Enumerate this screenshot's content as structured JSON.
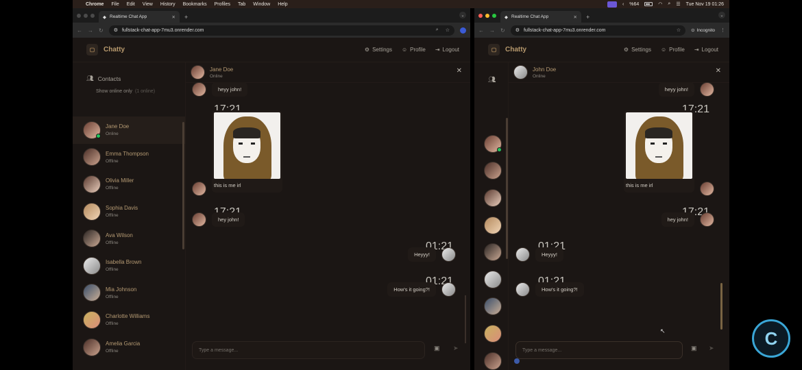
{
  "menubar": {
    "app": "Chrome",
    "items": [
      "File",
      "Edit",
      "View",
      "History",
      "Bookmarks",
      "Profiles",
      "Tab",
      "Window",
      "Help"
    ],
    "battery": "%64",
    "datetime": "Tue Nov 19  01:26"
  },
  "browser": {
    "tab_title": "Realtime Chat App",
    "url": "fullstack-chat-app-7mu3.onrender.com",
    "incognito_label": "Incognito"
  },
  "app": {
    "name": "Chatty",
    "nav": {
      "settings": "Settings",
      "profile": "Profile",
      "logout": "Logout"
    }
  },
  "left": {
    "sidebar": {
      "title": "Contacts",
      "online_filter": "Show online only",
      "online_count": "(1 online)",
      "contacts": [
        {
          "name": "Jane Doe",
          "status": "Online"
        },
        {
          "name": "Emma Thompson",
          "status": "Offline"
        },
        {
          "name": "Olivia Miller",
          "status": "Offline"
        },
        {
          "name": "Sophia Davis",
          "status": "Offline"
        },
        {
          "name": "Ava Wilson",
          "status": "Offline"
        },
        {
          "name": "Isabella Brown",
          "status": "Offline"
        },
        {
          "name": "Mia Johnson",
          "status": "Offline"
        },
        {
          "name": "Charlotte Williams",
          "status": "Offline"
        },
        {
          "name": "Amelia Garcia",
          "status": "Offline"
        }
      ]
    },
    "chat": {
      "name": "Jane Doe",
      "status": "Online",
      "messages": [
        {
          "text": "heyy john!",
          "time": ""
        },
        {
          "text": "this is me irl",
          "time": "17:21"
        },
        {
          "text": "hey john!",
          "time": "17:21"
        },
        {
          "text": "Heyyy!",
          "time": "01:21"
        },
        {
          "text": "How's it going?!",
          "time": "01:21"
        }
      ],
      "placeholder": "Type a message..."
    }
  },
  "right": {
    "chat": {
      "name": "John Doe",
      "status": "Online",
      "messages": [
        {
          "text": "heyy john!",
          "time": ""
        },
        {
          "text": "this is me irl",
          "time": "17:21"
        },
        {
          "text": "hey john!",
          "time": "17:21"
        },
        {
          "text": "Heyyy!",
          "time": "01:21"
        },
        {
          "text": "How's it going?!",
          "time": "01:21"
        }
      ],
      "placeholder": "Type a message..."
    }
  },
  "colors": {
    "accent": "#b59a73",
    "online": "#22c55e",
    "background": "#1b1614"
  }
}
